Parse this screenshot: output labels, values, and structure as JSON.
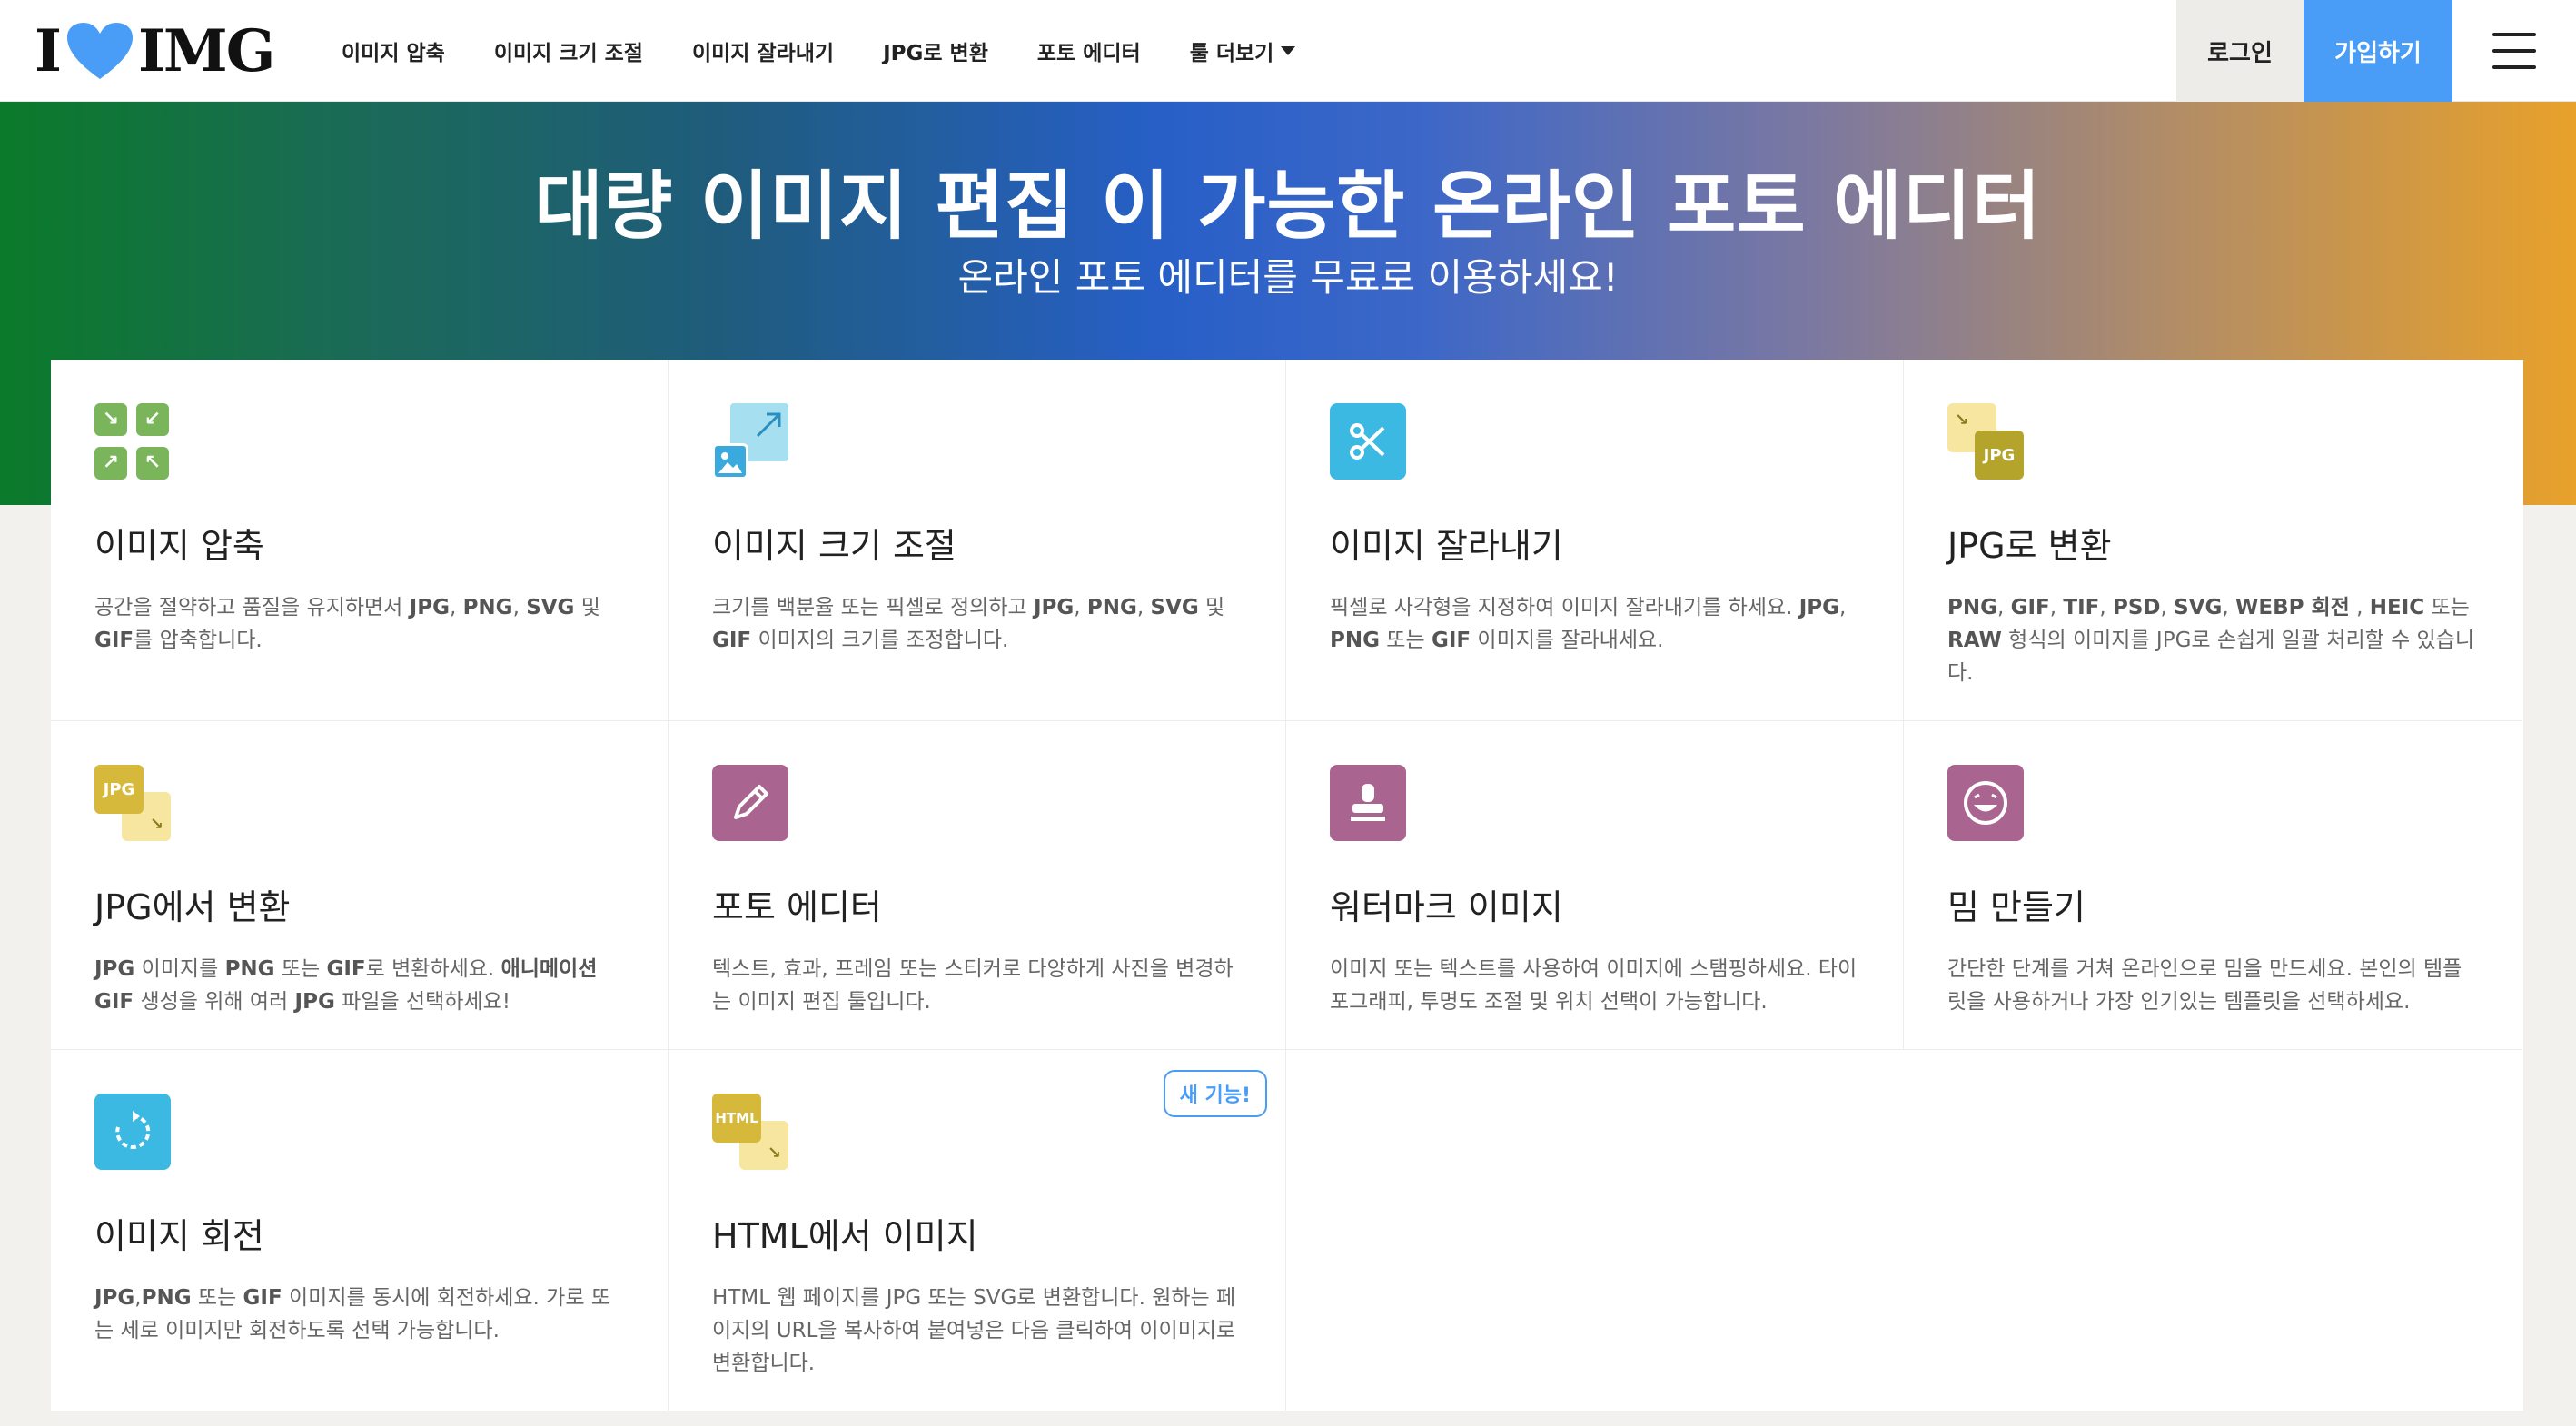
{
  "brand": {
    "logo_left": "I",
    "logo_right": "IMG",
    "heart_color": "#4a9df6"
  },
  "nav": {
    "items": [
      "이미지 압축",
      "이미지 크기 조절",
      "이미지 잘라내기",
      "JPG로 변환",
      "포토 에디터",
      "툴 더보기"
    ],
    "login": "로그인",
    "signup": "가입하기",
    "menu_icon": "hamburger-icon"
  },
  "hero": {
    "title": "대량 이미지 편집 이 가능한 온라인 포토 에디터",
    "subtitle": "온라인 포토 에디터를 무료로 이용하세요!"
  },
  "tools": [
    {
      "title": "이미지 압축",
      "icon": "compress-icon",
      "color": "#7ab55c",
      "desc": [
        [
          "공간을 절약하고 품질을 유지하면서 ",
          false
        ],
        [
          "JPG",
          true
        ],
        [
          ", ",
          false
        ],
        [
          "PNG",
          true
        ],
        [
          ", ",
          false
        ],
        [
          "SVG",
          true
        ],
        [
          " 및 ",
          false
        ],
        [
          "GIF",
          true
        ],
        [
          "를 압축합니다.",
          false
        ]
      ]
    },
    {
      "title": "이미지 크기 조절",
      "icon": "resize-icon",
      "color": "#49b7e0",
      "desc": [
        [
          "크기를 백분율 또는 픽셀로 정의하고 ",
          false
        ],
        [
          "JPG",
          true
        ],
        [
          ", ",
          false
        ],
        [
          "PNG",
          true
        ],
        [
          ", ",
          false
        ],
        [
          "SVG",
          true
        ],
        [
          " 및 ",
          false
        ],
        [
          "GIF",
          true
        ],
        [
          " 이미지의 크기를 조정합니다.",
          false
        ]
      ]
    },
    {
      "title": "이미지 잘라내기",
      "icon": "scissors-icon",
      "color": "#3bb9e3",
      "desc": [
        [
          "픽셀로 사각형을 지정하여 이미지 잘라내기를 하세요. ",
          false
        ],
        [
          "JPG",
          true
        ],
        [
          ", ",
          false
        ],
        [
          "PNG",
          true
        ],
        [
          " 또는 ",
          false
        ],
        [
          "GIF",
          true
        ],
        [
          " 이미지를 잘라내세요.",
          false
        ]
      ]
    },
    {
      "title": "JPG로 변환",
      "icon": "to-jpg-icon",
      "color": "#c3b22e",
      "desc": [
        [
          "PNG",
          true
        ],
        [
          ", ",
          false
        ],
        [
          "GIF",
          true
        ],
        [
          ", ",
          false
        ],
        [
          "TIF",
          true
        ],
        [
          ", ",
          false
        ],
        [
          "PSD",
          true
        ],
        [
          ", ",
          false
        ],
        [
          "SVG",
          true
        ],
        [
          ", ",
          false
        ],
        [
          "WEBP 회전",
          true
        ],
        [
          " , ",
          false
        ],
        [
          "HEIC",
          true
        ],
        [
          " 또는 ",
          false
        ],
        [
          "RAW",
          true
        ],
        [
          " 형식의 이미지를 JPG로 손쉽게 일괄 처리할 수 있습니다.",
          false
        ]
      ]
    },
    {
      "title": "JPG에서 변환",
      "icon": "from-jpg-icon",
      "color": "#d6b93a",
      "desc": [
        [
          "JPG",
          true
        ],
        [
          " 이미지를 ",
          false
        ],
        [
          "PNG",
          true
        ],
        [
          " 또는 ",
          false
        ],
        [
          "GIF",
          true
        ],
        [
          "로 변환하세요. ",
          false
        ],
        [
          "애니메이션 GIF",
          true
        ],
        [
          " 생성을 위해 여러 ",
          false
        ],
        [
          "JPG",
          true
        ],
        [
          " 파일을 선택하세요!",
          false
        ]
      ]
    },
    {
      "title": "포토 에디터",
      "icon": "pencil-icon",
      "color": "#a9658f",
      "desc": [
        [
          "텍스트, 효과, 프레임 또는 스티커로 다양하게 사진을 변경하는 이미지 편집 툴입니다.",
          false
        ]
      ]
    },
    {
      "title": "워터마크 이미지",
      "icon": "stamp-icon",
      "color": "#a9658f",
      "desc": [
        [
          "이미지 또는 텍스트를 사용하여 이미지에 스탬핑하세요. 타이포그래피, 투명도 조절 및 위치 선택이 가능합니다.",
          false
        ]
      ]
    },
    {
      "title": "밈 만들기",
      "icon": "laugh-icon",
      "color": "#a9658f",
      "desc": [
        [
          "간단한 단계를 거쳐 온라인으로 밈을 만드세요. 본인의 템플릿을 사용하거나 가장 인기있는 템플릿을 선택하세요.",
          false
        ]
      ]
    },
    {
      "title": "이미지 회전",
      "icon": "rotate-icon",
      "color": "#3bb9e3",
      "desc": [
        [
          "JPG",
          true
        ],
        [
          ",",
          false
        ],
        [
          "PNG",
          true
        ],
        [
          " 또는 ",
          false
        ],
        [
          "GIF",
          true
        ],
        [
          " 이미지를 동시에 회전하세요. 가로 또는 세로 이미지만 회전하도록 선택 가능합니다.",
          false
        ]
      ]
    },
    {
      "title": "HTML에서 이미지",
      "icon": "html-icon",
      "color": "#d6b93a",
      "badge": "새 기능!",
      "desc": [
        [
          "HTML 웹 페이지를 JPG 또는 SVG로 변환합니다. 원하는 페이지의 URL을 복사하여 붙여넣은 다음 클릭하여 이이미지로 변환합니다.",
          false
        ]
      ]
    }
  ]
}
